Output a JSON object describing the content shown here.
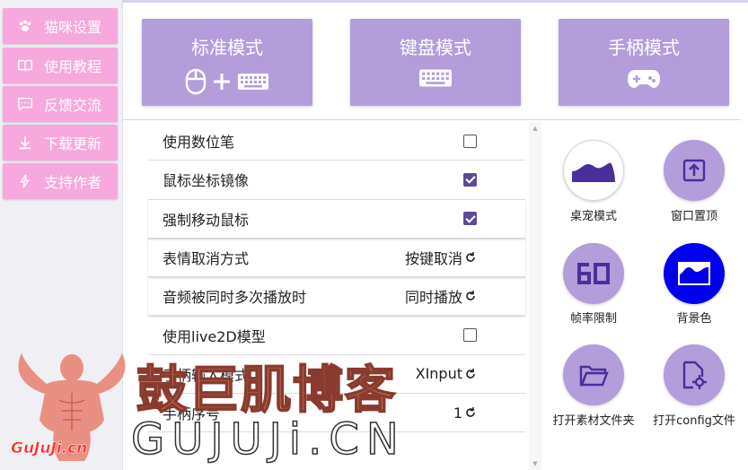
{
  "sidebar": {
    "items": [
      {
        "label": "猫咪设置",
        "icon": "paw-icon"
      },
      {
        "label": "使用教程",
        "icon": "book-icon"
      },
      {
        "label": "反馈交流",
        "icon": "chat-icon"
      },
      {
        "label": "下载更新",
        "icon": "download-icon"
      },
      {
        "label": "支持作者",
        "icon": "lightning-icon"
      }
    ]
  },
  "modes": [
    {
      "label": "标准模式",
      "icon": "mouse-keyboard-icon"
    },
    {
      "label": "键盘模式",
      "icon": "keyboard-icon"
    },
    {
      "label": "手柄模式",
      "icon": "gamepad-icon"
    }
  ],
  "settings": [
    {
      "label": "使用数位笔",
      "type": "checkbox",
      "checked": false
    },
    {
      "label": "鼠标坐标镜像",
      "type": "checkbox",
      "checked": true
    },
    {
      "label": "强制移动鼠标",
      "type": "checkbox",
      "checked": true
    },
    {
      "label": "表情取消方式",
      "type": "cycle",
      "value": "按键取消"
    },
    {
      "label": "音频被同时多次播放时",
      "type": "cycle",
      "value": "同时播放"
    },
    {
      "label": "使用live2D模型",
      "type": "checkbox",
      "checked": false
    },
    {
      "label": "手柄输入模式",
      "type": "cycle",
      "value": "XInput"
    },
    {
      "label": "手柄序号",
      "type": "cycle",
      "value": "1"
    }
  ],
  "actions": [
    {
      "label": "桌宠模式",
      "icon": "pet-mode-icon"
    },
    {
      "label": "窗口置顶",
      "icon": "pin-top-icon"
    },
    {
      "label": "帧率限制",
      "icon": "fps-60-icon"
    },
    {
      "label": "背景色",
      "icon": "background-color-icon"
    },
    {
      "label": "打开素材文件夹",
      "icon": "folder-open-icon"
    },
    {
      "label": "打开config文件",
      "icon": "config-file-icon"
    }
  ],
  "watermark": {
    "title": "鼓巨肌博客",
    "domain": "GUJUJi.CN",
    "small": "GuJuJi.cn"
  },
  "colors": {
    "sidebar_pink": "#f7a8dc",
    "accent_purple": "#b39ddb",
    "checkbox_purple": "#5b4a9c",
    "bg_blue": "#0000ee"
  }
}
